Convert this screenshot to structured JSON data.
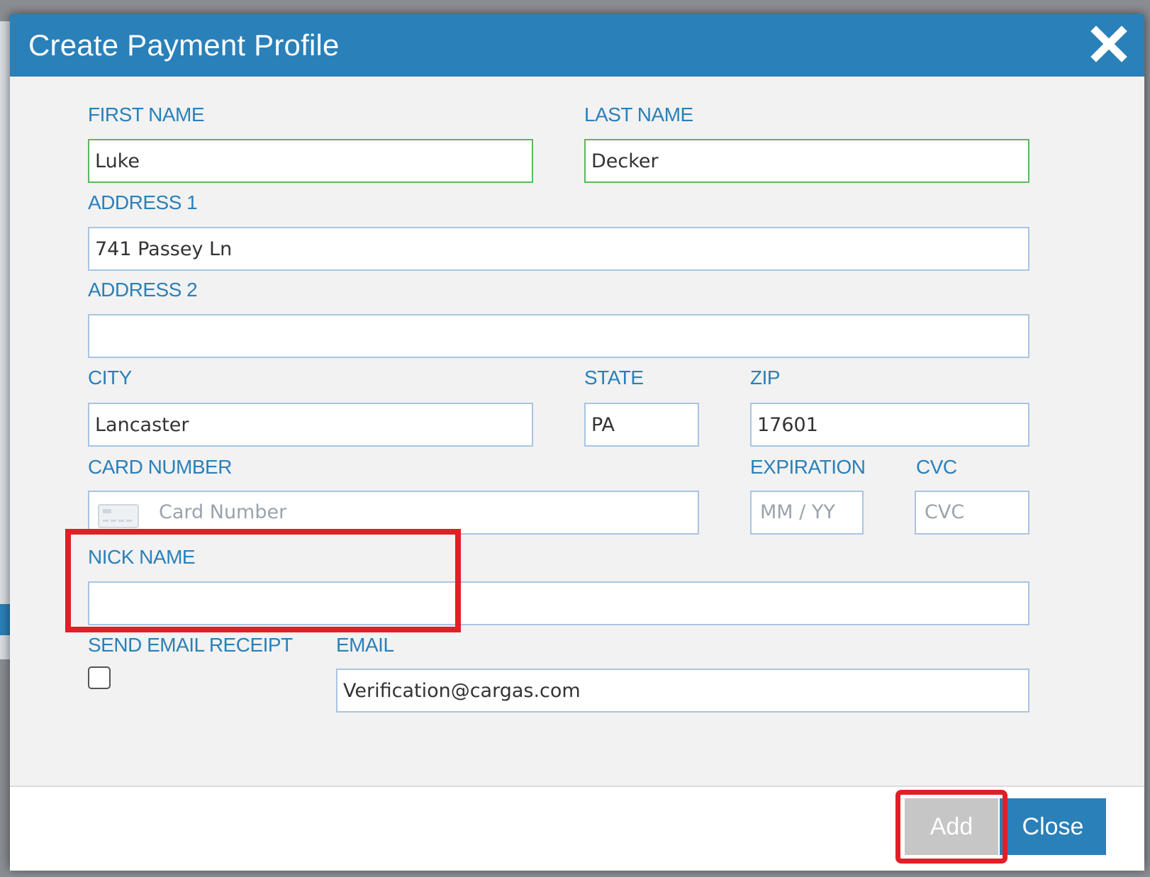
{
  "dialog": {
    "title": "Create Payment Profile",
    "close_icon": "close-icon"
  },
  "form": {
    "first_name": {
      "label": "FIRST NAME",
      "value": "Luke"
    },
    "last_name": {
      "label": "LAST NAME",
      "value": "Decker"
    },
    "address1": {
      "label": "ADDRESS 1",
      "value": "741 Passey Ln"
    },
    "address2": {
      "label": "ADDRESS 2",
      "value": ""
    },
    "city": {
      "label": "CITY",
      "value": "Lancaster"
    },
    "state": {
      "label": "STATE",
      "value": "PA"
    },
    "zip": {
      "label": "ZIP",
      "value": "17601"
    },
    "card_number": {
      "label": "CARD NUMBER",
      "placeholder": "Card Number",
      "icon": "credit-card-icon"
    },
    "expiration": {
      "label": "EXPIRATION",
      "placeholder": "MM / YY"
    },
    "cvc": {
      "label": "CVC",
      "placeholder": "CVC"
    },
    "nick_name": {
      "label": "NICK NAME",
      "value": ""
    },
    "send_email_receipt": {
      "label": "SEND EMAIL RECEIPT",
      "checked": false
    },
    "email": {
      "label": "EMAIL",
      "value": "Verification@cargas.com"
    }
  },
  "footer": {
    "add_label": "Add",
    "close_label": "Close"
  },
  "colors": {
    "header": "#2a80b9",
    "label": "#2a80b9",
    "valid_border": "#5cb85c",
    "highlight": "#e01f26",
    "add_disabled": "#c6c6c6"
  }
}
